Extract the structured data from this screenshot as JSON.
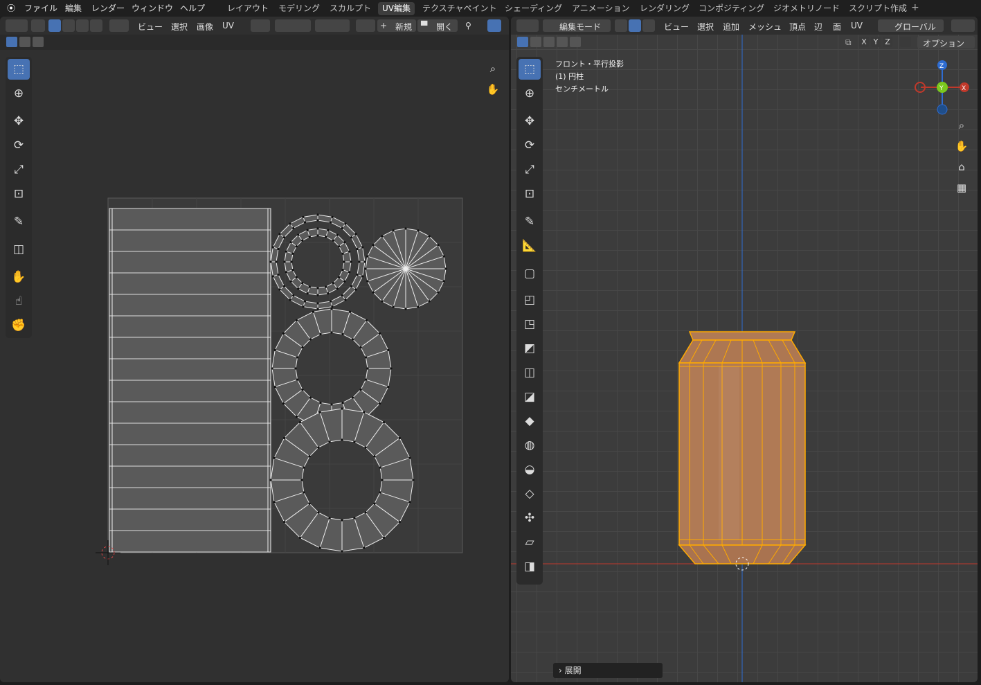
{
  "menu": [
    "ファイル",
    "編集",
    "レンダー",
    "ウィンドウ",
    "ヘルプ"
  ],
  "workspaces": [
    "レイアウト",
    "モデリング",
    "スカルプト",
    "UV編集",
    "テクスチャペイント",
    "シェーディング",
    "アニメーション",
    "レンダリング",
    "コンポジティング",
    "ジオメトリノード",
    "スクリプト作成"
  ],
  "active_workspace": "UV編集",
  "uv_editor": {
    "header": {
      "view": "ビュー",
      "select": "選択",
      "image": "画像",
      "uv": "UV",
      "new": "新規",
      "open": "開く"
    },
    "tools": [
      "select-box",
      "cursor",
      "move",
      "rotate",
      "scale",
      "transform",
      "annotate",
      "rip-region",
      "grab",
      "relax",
      "pinch"
    ]
  },
  "viewport": {
    "header": {
      "mode": "編集モード",
      "view": "ビュー",
      "select": "選択",
      "add": "追加",
      "mesh": "メッシュ",
      "vertex": "頂点",
      "edge": "辺",
      "face": "面",
      "uv": "UV",
      "orientation": "グローバル",
      "options": "オプション"
    },
    "axes": {
      "x": "X",
      "y": "Y",
      "z": "Z"
    },
    "overlay": {
      "line1": "フロント・平行投影",
      "line2": "(1) 円柱",
      "line3": "センチメートル"
    },
    "gizmo": {
      "z": "Z",
      "y": "Y",
      "x": "X"
    },
    "last_op_panel": "展開"
  },
  "colors": {
    "accent": "#4772b3",
    "selection": "#ffaa00",
    "mesh_fill": "#b07a55",
    "x_axis": "#c0392b",
    "z_axis": "#2e6cd1"
  }
}
